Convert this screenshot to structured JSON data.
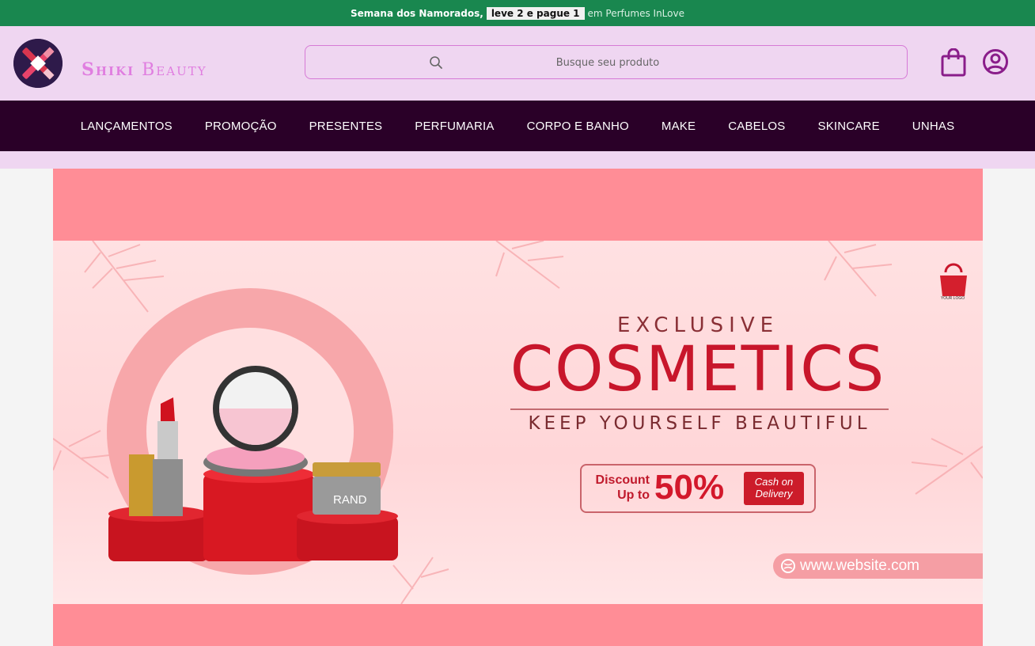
{
  "promo": {
    "text_bold": "Semana dos Namorados,",
    "highlight": "leve 2 e pague 1",
    "rest": "em Perfumes InLove"
  },
  "header": {
    "brand_first": "Shiki",
    "brand_second": "Beauty",
    "search_placeholder": "Busque seu produto"
  },
  "nav": {
    "items": [
      {
        "label": "LANÇAMENTOS"
      },
      {
        "label": "PROMOÇÃO"
      },
      {
        "label": "PRESENTES"
      },
      {
        "label": "PERFUMARIA"
      },
      {
        "label": "CORPO E BANHO"
      },
      {
        "label": "MAKE"
      },
      {
        "label": "CABELOS"
      },
      {
        "label": "SKINCARE"
      },
      {
        "label": "UNHAS"
      }
    ]
  },
  "banner": {
    "exclusive": "EXCLUSIVE",
    "cosmetics": "COSMETICS",
    "tagline": "KEEP YOURSELF BEAUTIFUL",
    "discount_label": "Discount Up to",
    "discount_value": "50%",
    "cod_label": "Cash on Delivery",
    "website": "www.website.com",
    "logo_text": "YOUR LOGO",
    "jar_label": "RAND"
  },
  "colors": {
    "promo_bg": "#19874f",
    "header_bg": "#efd6f1",
    "nav_bg": "#2a0028",
    "accent": "#d67ad6",
    "banner_bg": "#ff8d96",
    "brand_red": "#c8162b"
  },
  "icons": {
    "search": "search-icon",
    "cart": "shopping-bag-icon",
    "user": "user-account-icon"
  }
}
